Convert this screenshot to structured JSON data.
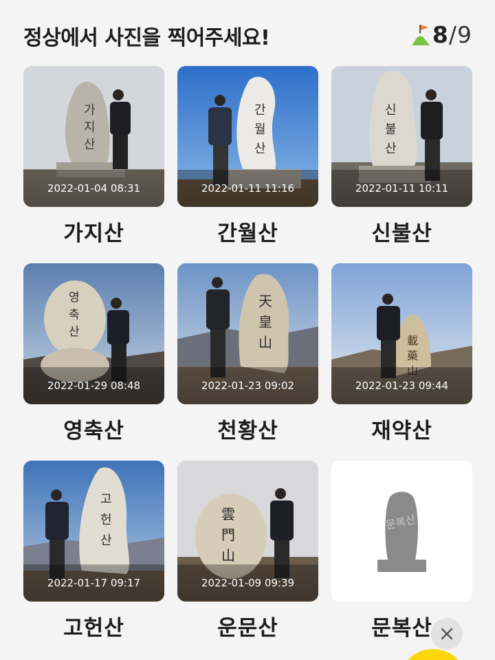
{
  "header": {
    "title": "정상에서 사진을 찍어주세요!",
    "progress": {
      "collected": "8",
      "separator": "/",
      "total": "9"
    }
  },
  "mountains": [
    {
      "name": "가지산",
      "timestamp": "2022-01-04 08:31",
      "photographed": true
    },
    {
      "name": "간월산",
      "timestamp": "2022-01-11 11:16",
      "photographed": true
    },
    {
      "name": "신불산",
      "timestamp": "2022-01-11 10:11",
      "photographed": true
    },
    {
      "name": "영축산",
      "timestamp": "2022-01-29 08:48",
      "photographed": true
    },
    {
      "name": "천황산",
      "timestamp": "2022-01-23 09:02",
      "photographed": true
    },
    {
      "name": "재약산",
      "timestamp": "2022-01-23 09:44",
      "photographed": true
    },
    {
      "name": "고헌산",
      "timestamp": "2022-01-17 09:17",
      "photographed": true
    },
    {
      "name": "운문산",
      "timestamp": "2022-01-09 09:39",
      "photographed": true
    },
    {
      "name": "문복산",
      "timestamp": "",
      "photographed": false
    }
  ],
  "placeholder_stone_text": "문복산",
  "icons": {
    "progress": "mountain-flag-icon",
    "close": "close-icon"
  },
  "colors": {
    "fab": "#fbd60b",
    "flag": "#f07a2a",
    "mountain": "#7cc242",
    "placeholder_stone": "#8a8a8a"
  }
}
